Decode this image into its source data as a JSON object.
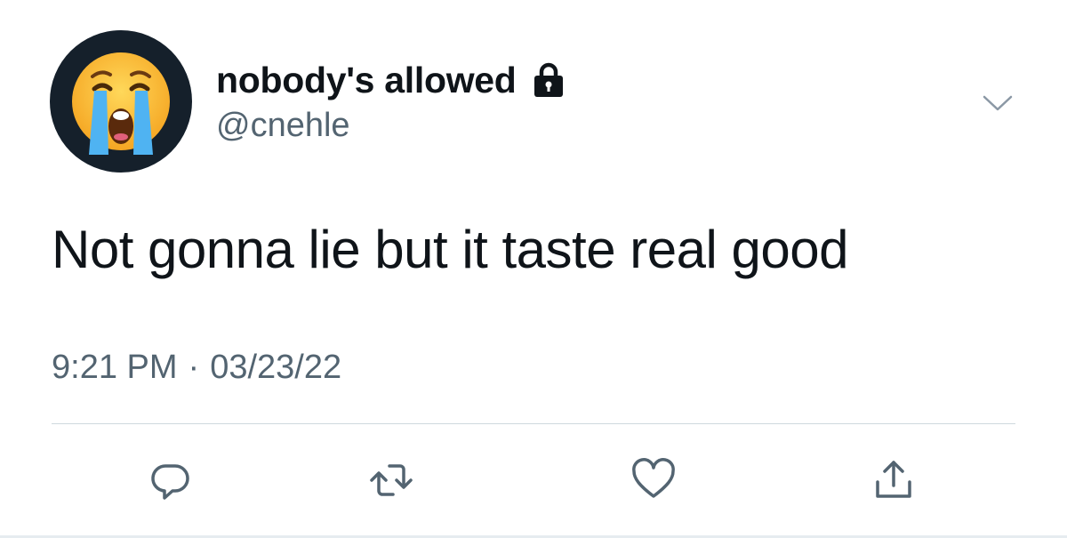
{
  "tweet": {
    "author": {
      "display_name": "nobody's allowed",
      "handle": "@cnehle",
      "avatar_icon": "loudly-crying-face-emoji",
      "protected_icon": "lock-icon"
    },
    "text": "Not gonna lie but it taste real good",
    "time": "9:21 PM",
    "separator": "·",
    "date": "03/23/22",
    "menu_icon": "chevron-down-icon"
  },
  "actions": [
    {
      "icon": "reply-icon"
    },
    {
      "icon": "retweet-icon"
    },
    {
      "icon": "like-icon"
    },
    {
      "icon": "share-icon"
    }
  ],
  "colors": {
    "text_primary": "#0f1419",
    "text_secondary": "#536471",
    "icon": "#536471",
    "divider": "#cfd9de",
    "avatar_bg": "#15202b"
  }
}
